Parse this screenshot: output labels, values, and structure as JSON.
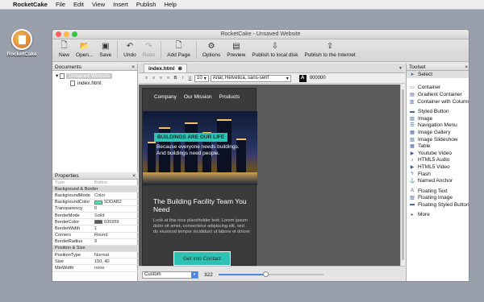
{
  "menubar": {
    "app": "RocketCake",
    "items": [
      "File",
      "Edit",
      "View",
      "Insert",
      "Publish",
      "Help"
    ]
  },
  "desktop": {
    "icon_label": "RocketCake"
  },
  "window": {
    "title": "RocketCake - Unsaved Website"
  },
  "toolbar": {
    "items": [
      {
        "label": "New",
        "icon": "new-page-icon",
        "enabled": true
      },
      {
        "label": "Open...",
        "icon": "open-folder-icon",
        "enabled": true
      },
      {
        "label": "Save",
        "icon": "save-icon",
        "enabled": true
      },
      {
        "label": "Undo",
        "icon": "undo-icon",
        "enabled": true
      },
      {
        "label": "Redo",
        "icon": "redo-icon",
        "enabled": false
      },
      {
        "label": "Add Page",
        "icon": "add-page-icon",
        "enabled": true
      },
      {
        "label": "Options",
        "icon": "gear-icon",
        "enabled": true
      },
      {
        "label": "Preview",
        "icon": "preview-icon",
        "enabled": true
      },
      {
        "label": "Publish to local disk",
        "icon": "publish-disk-icon",
        "enabled": true
      },
      {
        "label": "Publish to the Internet",
        "icon": "publish-internet-icon",
        "enabled": true
      }
    ]
  },
  "documents": {
    "title": "Documents",
    "root": "Unsaved Website",
    "files": [
      "index.html"
    ]
  },
  "properties": {
    "title": "Properties",
    "rows": [
      {
        "key": "Type",
        "value": "Button",
        "kind": "dim"
      },
      {
        "key": "Background & Border",
        "value": "",
        "kind": "header"
      },
      {
        "key": "BackgroundMode",
        "value": "Color",
        "kind": "row"
      },
      {
        "key": "BackgroundColor",
        "value": "5DDAB2",
        "kind": "row",
        "swatch": "#5ddab2"
      },
      {
        "key": "Transparency",
        "value": "0",
        "kind": "row"
      },
      {
        "key": "BorderMode",
        "value": "Solid",
        "kind": "row"
      },
      {
        "key": "BorderColor",
        "value": "595959",
        "kind": "row",
        "swatch": "#595959"
      },
      {
        "key": "BorderWidth",
        "value": "1",
        "kind": "row"
      },
      {
        "key": "Corners",
        "value": "Round",
        "kind": "row"
      },
      {
        "key": "BorderRadius",
        "value": "9",
        "kind": "row"
      },
      {
        "key": "Position & Size",
        "value": "",
        "kind": "header"
      },
      {
        "key": "PositionType",
        "value": "Normal",
        "kind": "row"
      },
      {
        "key": "Size",
        "value": "150, 40",
        "kind": "row"
      },
      {
        "key": "MinWidth",
        "value": "none",
        "kind": "row"
      }
    ]
  },
  "editor": {
    "tab": "index.html",
    "font_size": "10",
    "font_family": "Arial, Helvetica, sans-serif",
    "color_value": "000000",
    "page": {
      "nav": [
        "Company",
        "Our Mission",
        "Products"
      ],
      "badge": "BUILDINGS ARE OUR LIFE",
      "hero_text": [
        "Because everyone needs buildings.",
        "And buildings need people."
      ],
      "title": "The Building Facility Team You Need",
      "body": "Look at this nice placeholder text: Lorem ipsum dolor sit amet, consectetur adipiscing elit, sed do eiusmod tempor incididunt ut labore et dolore",
      "button": "Get into Contact"
    },
    "status": {
      "zoom_mode": "Custom",
      "width": "322",
      "slider_fraction": 0.45
    }
  },
  "toolset": {
    "title": "Toolset",
    "groups": [
      [
        {
          "label": "Select",
          "icon": "cursor-icon",
          "selected": true
        }
      ],
      [
        {
          "label": "Container",
          "icon": "container-icon"
        },
        {
          "label": "Gradient Container",
          "icon": "gradient-container-icon"
        },
        {
          "label": "Container with Column",
          "icon": "column-container-icon"
        }
      ],
      [
        {
          "label": "Styled Button",
          "icon": "button-icon"
        },
        {
          "label": "Image",
          "icon": "image-icon"
        },
        {
          "label": "Navigation Menu",
          "icon": "menu-icon"
        },
        {
          "label": "Image Gallery",
          "icon": "gallery-icon"
        },
        {
          "label": "Image Slideshow",
          "icon": "slideshow-icon"
        },
        {
          "label": "Table",
          "icon": "table-icon"
        },
        {
          "label": "Youtube Video",
          "icon": "video-icon"
        },
        {
          "label": "HTML5 Audio",
          "icon": "audio-icon"
        },
        {
          "label": "HTML5 Video",
          "icon": "video-icon"
        },
        {
          "label": "Flash",
          "icon": "flash-icon"
        },
        {
          "label": "Named Anchor",
          "icon": "anchor-icon"
        }
      ],
      [
        {
          "label": "Floating Text",
          "icon": "text-icon"
        },
        {
          "label": "Floating Image",
          "icon": "image-icon"
        },
        {
          "label": "Floating Styled Button",
          "icon": "button-icon"
        }
      ],
      [
        {
          "label": "More",
          "icon": "more-arrow-icon"
        }
      ]
    ]
  },
  "colors": {
    "accent": "#2ec2b5",
    "page_bg": "#3b3b3b",
    "canvas_bg": "#5a5a5a"
  }
}
